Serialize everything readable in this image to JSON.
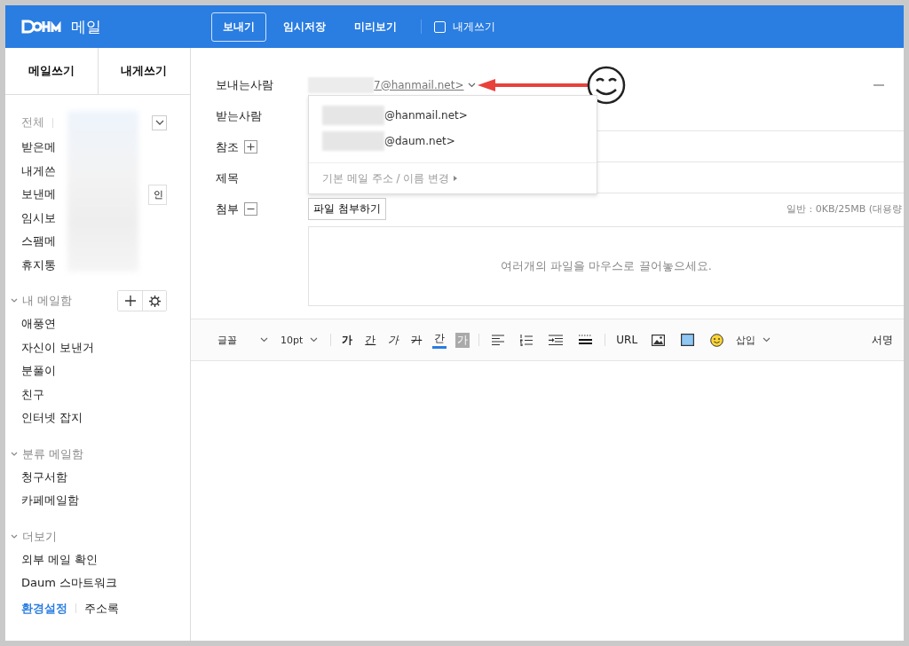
{
  "header": {
    "logo": "메일",
    "actions": [
      {
        "label": "보내기",
        "kind": "primary"
      },
      {
        "label": "임시저장",
        "kind": "plain"
      },
      {
        "label": "미리보기",
        "kind": "plain"
      }
    ],
    "self_mail": {
      "label": "내게쓰기",
      "checked": false
    }
  },
  "sidebar": {
    "tabs": [
      {
        "label": "메일쓰기",
        "selected": false
      },
      {
        "label": "내게쓰기",
        "selected": false
      }
    ],
    "all_label": "전체",
    "folders": [
      "받은메",
      "내게쓴",
      "보낸메",
      "임시보",
      "스팸메",
      "휴지통"
    ],
    "confirm_button": "인",
    "sections": [
      {
        "title": "내 메일함",
        "expanded": true,
        "tools": true,
        "items": [
          "애풍연",
          "자신이 보낸거",
          "분풀이",
          "친구",
          "인터넷 잡지"
        ]
      },
      {
        "title": "분류 메일함",
        "expanded": true,
        "tools": false,
        "items": [
          "청구서함",
          "카페메일함"
        ]
      },
      {
        "title": "더보기",
        "expanded": true,
        "tools": false,
        "items": [
          "외부 메일 확인",
          "Daum 스마트워크"
        ]
      }
    ],
    "footer_links": [
      {
        "label": "환경설정",
        "selected": true
      },
      {
        "label": "주소록",
        "selected": false
      }
    ]
  },
  "compose": {
    "fields": [
      {
        "label": "보내는사람",
        "kind": "sender",
        "value": "7@hanmail.net>"
      },
      {
        "label": "받는사람",
        "kind": "input"
      },
      {
        "label": "참조",
        "kind": "plus"
      },
      {
        "label": "제목",
        "kind": "input"
      },
      {
        "label": "첨부",
        "kind": "attach"
      }
    ],
    "sender_menu": {
      "options": [
        "@hanmail.net>",
        "@daum.net>"
      ],
      "footer": "기본 메일 주소 / 이름 변경"
    },
    "attach_button": "파일 첨부하기",
    "attach_quota": "일반 : 0KB/25MB (대용량",
    "drop_hint": "여러개의 파일을 마우스로 끌어놓으세요.",
    "toolbar": [
      {
        "kind": "select",
        "label": "글꼴"
      },
      {
        "kind": "select",
        "label": "10pt"
      },
      {
        "kind": "sep"
      },
      {
        "kind": "bold",
        "label": "가"
      },
      {
        "kind": "underline",
        "label": "간"
      },
      {
        "kind": "italic",
        "label": "가"
      },
      {
        "kind": "strike",
        "label": "가"
      },
      {
        "kind": "color",
        "label": "간"
      },
      {
        "kind": "bg",
        "label": "가"
      },
      {
        "kind": "sep"
      },
      {
        "kind": "align"
      },
      {
        "kind": "list"
      },
      {
        "kind": "indent"
      },
      {
        "kind": "rule"
      },
      {
        "kind": "sep"
      },
      {
        "kind": "text",
        "label": "URL"
      },
      {
        "kind": "image"
      },
      {
        "kind": "box"
      },
      {
        "kind": "emoji"
      },
      {
        "kind": "select",
        "label": "삽입"
      },
      {
        "kind": "spacer"
      },
      {
        "kind": "text",
        "label": "서명"
      }
    ]
  }
}
